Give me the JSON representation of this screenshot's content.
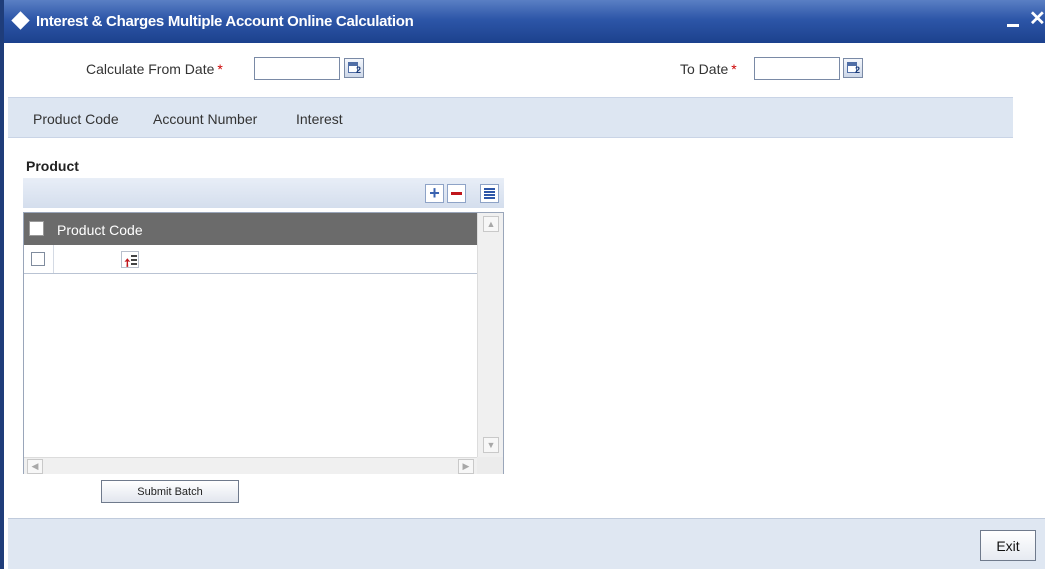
{
  "window": {
    "title": "Interest & Charges Multiple Account Online Calculation",
    "minimize_glyph": "_",
    "close_glyph": "✕"
  },
  "form": {
    "from_date_label": "Calculate From Date",
    "from_date_value": "",
    "to_date_label": "To Date",
    "to_date_value": "",
    "required_marker": "*",
    "calendar_glyph_number": "2"
  },
  "tabs": [
    {
      "label": "Product Code"
    },
    {
      "label": "Account Number"
    },
    {
      "label": "Interest"
    }
  ],
  "product_section": {
    "title": "Product",
    "toolbar": {
      "add_glyph": "+"
    },
    "columns": [
      {
        "label": "Product Code"
      }
    ],
    "rows": [
      {
        "product_code": ""
      }
    ]
  },
  "actions": {
    "submit_batch_label": "Submit Batch",
    "exit_label": "Exit"
  },
  "icons": {
    "title": "diamond-icon",
    "calendar": "calendar-icon",
    "add": "plus-icon",
    "delete": "minus-icon",
    "view": "list-view-icon",
    "lov": "lov-icon"
  },
  "colors": {
    "titlebar": "#2d56a8",
    "tabstrip": "#dde6f2",
    "grid_header": "#6b6b6b",
    "required": "#cc0000"
  }
}
